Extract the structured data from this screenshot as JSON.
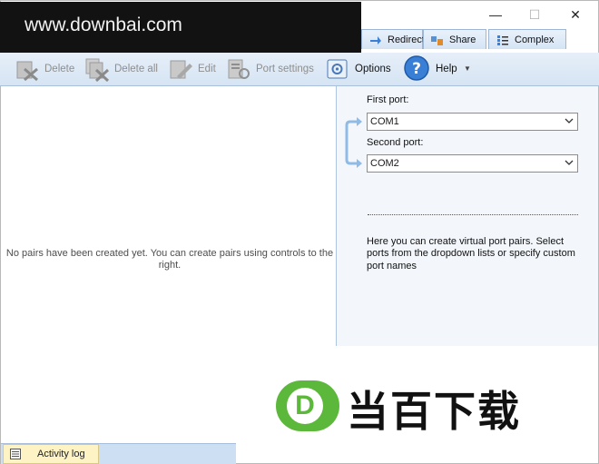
{
  "watermark": {
    "text": "www.downbai.com"
  },
  "window_controls": {
    "minimize": "—",
    "maximize": "☐",
    "close": "✕"
  },
  "tabs": [
    {
      "label": "Redirect",
      "icon": "redirect-icon"
    },
    {
      "label": "Share",
      "icon": "share-icon"
    },
    {
      "label": "Complex",
      "icon": "complex-icon"
    }
  ],
  "toolbar": {
    "delete": "Delete",
    "delete_all": "Delete all",
    "edit": "Edit",
    "port_settings": "Port settings",
    "options": "Options",
    "help": "Help"
  },
  "left_pane": {
    "empty_message": "No pairs have been created yet. You can create pairs using controls to the right."
  },
  "right_pane": {
    "first_port_label": "First port:",
    "first_port_value": "COM1",
    "second_port_label": "Second port:",
    "second_port_value": "COM2",
    "help_text": "Here you can create virtual port pairs. Select ports from the dropdown lists or specify custom port names"
  },
  "logo": {
    "letter": "D",
    "text": "当百下载"
  },
  "status": {
    "activity_log": "Activity log"
  },
  "colors": {
    "accent": "#3c7fd4",
    "logo_green": "#5cb83a",
    "toolbar_bg": "#dbe7f5"
  }
}
